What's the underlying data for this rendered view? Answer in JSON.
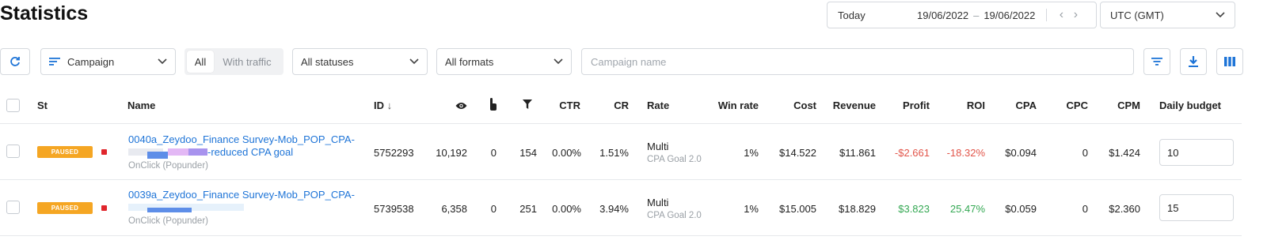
{
  "page": {
    "title": "Statistics"
  },
  "date_range": {
    "preset": "Today",
    "from": "19/06/2022",
    "separator": "–",
    "to": "19/06/2022"
  },
  "timezone": {
    "value": "UTC (GMT)"
  },
  "toolbar": {
    "group_by": "Campaign",
    "traffic_filter": {
      "all": "All",
      "with_traffic": "With traffic"
    },
    "status_select": "All statuses",
    "format_select": "All formats",
    "search_placeholder": "Campaign name"
  },
  "table": {
    "headers": {
      "status": "St",
      "name": "Name",
      "id": "ID",
      "id_sort": "↓",
      "ctr": "CTR",
      "cr": "CR",
      "rate": "Rate",
      "win_rate": "Win rate",
      "cost": "Cost",
      "revenue": "Revenue",
      "profit": "Profit",
      "roi": "ROI",
      "cpa": "CPA",
      "cpc": "CPC",
      "cpm": "CPM",
      "daily_budget": "Daily budget"
    },
    "header_icons": [
      "eye-icon",
      "click-icon",
      "funnel-icon"
    ],
    "rows": [
      {
        "status": "PAUSED",
        "name_line1": "0040a_Zeydoo_Finance Survey-Mob_POP_CPA-",
        "name_line2": "-reduced CPA goal",
        "format": "OnClick (Popunder)",
        "id": "5752293",
        "impressions": "10,192",
        "clicks": "0",
        "conversions": "154",
        "ctr": "0.00%",
        "cr": "1.51%",
        "rate": "Multi",
        "rate_sub": "CPA Goal 2.0",
        "win_rate": "1%",
        "cost": "$14.522",
        "revenue": "$11.861",
        "profit": "-$2.661",
        "roi": "-18.32%",
        "cpa": "$0.094",
        "cpc": "0",
        "cpm": "$1.424",
        "daily_budget": "10"
      },
      {
        "status": "PAUSED",
        "name_line1": "0039a_Zeydoo_Finance Survey-Mob_POP_CPA-",
        "name_line2": "",
        "format": "OnClick (Popunder)",
        "id": "5739538",
        "impressions": "6,358",
        "clicks": "0",
        "conversions": "251",
        "ctr": "0.00%",
        "cr": "3.94%",
        "rate": "Multi",
        "rate_sub": "CPA Goal 2.0",
        "win_rate": "1%",
        "cost": "$15.005",
        "revenue": "$18.829",
        "profit": "$3.823",
        "roi": "25.47%",
        "cpa": "$0.059",
        "cpc": "0",
        "cpm": "$2.360",
        "daily_budget": "15"
      }
    ]
  },
  "colors": {
    "accent": "#1e74d7",
    "paused": "#f5a623",
    "negative": "#e2554a",
    "positive": "#34a853"
  }
}
